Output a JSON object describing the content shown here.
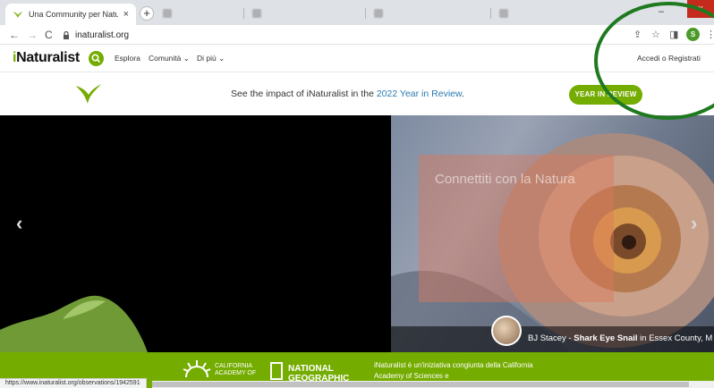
{
  "browser": {
    "active_tab": {
      "title": "Una Community per Naturalisti",
      "close": "×"
    },
    "new_tab": "+",
    "background_tabs": [],
    "nav": {
      "back": "←",
      "forward": "→",
      "reload": "C"
    },
    "url": "inaturalist.org",
    "profile_initial": "S",
    "window": {
      "minimize": "–",
      "close": "×"
    }
  },
  "site": {
    "logo": {
      "prefix": "i",
      "rest": "Naturalist"
    },
    "nav": [
      {
        "label": "Esplora"
      },
      {
        "label": "Comunità ⌄"
      },
      {
        "label": "Di più ⌄"
      }
    ],
    "login": "Accedi o Registrati"
  },
  "banner": {
    "text_before": "See the impact of iNaturalist in the ",
    "highlight": "2022 Year in Review",
    "text_after": ".",
    "button": "YEAR IN REVIEW"
  },
  "hero": {
    "title": "Connettiti con la Natura",
    "caption_user": "BJ Stacey",
    "caption_sep": " - ",
    "caption_species": "Shark Eye Snail",
    "caption_place": " in Essex County, M",
    "prev": "‹",
    "next": "›"
  },
  "footer": {
    "cas": "CALIFORNIA ACADEMY OF",
    "ng": "NATIONAL GEOGRAPHIC",
    "text": "iNaturalist è un'iniziativa congiunta della California Academy of Sciences e"
  },
  "status": {
    "url": "https://www.inaturalist.org/observations/1942591"
  },
  "colors": {
    "brand": "#74ac00",
    "annotation": "#1f7a1f",
    "link": "#2a7ab0"
  }
}
